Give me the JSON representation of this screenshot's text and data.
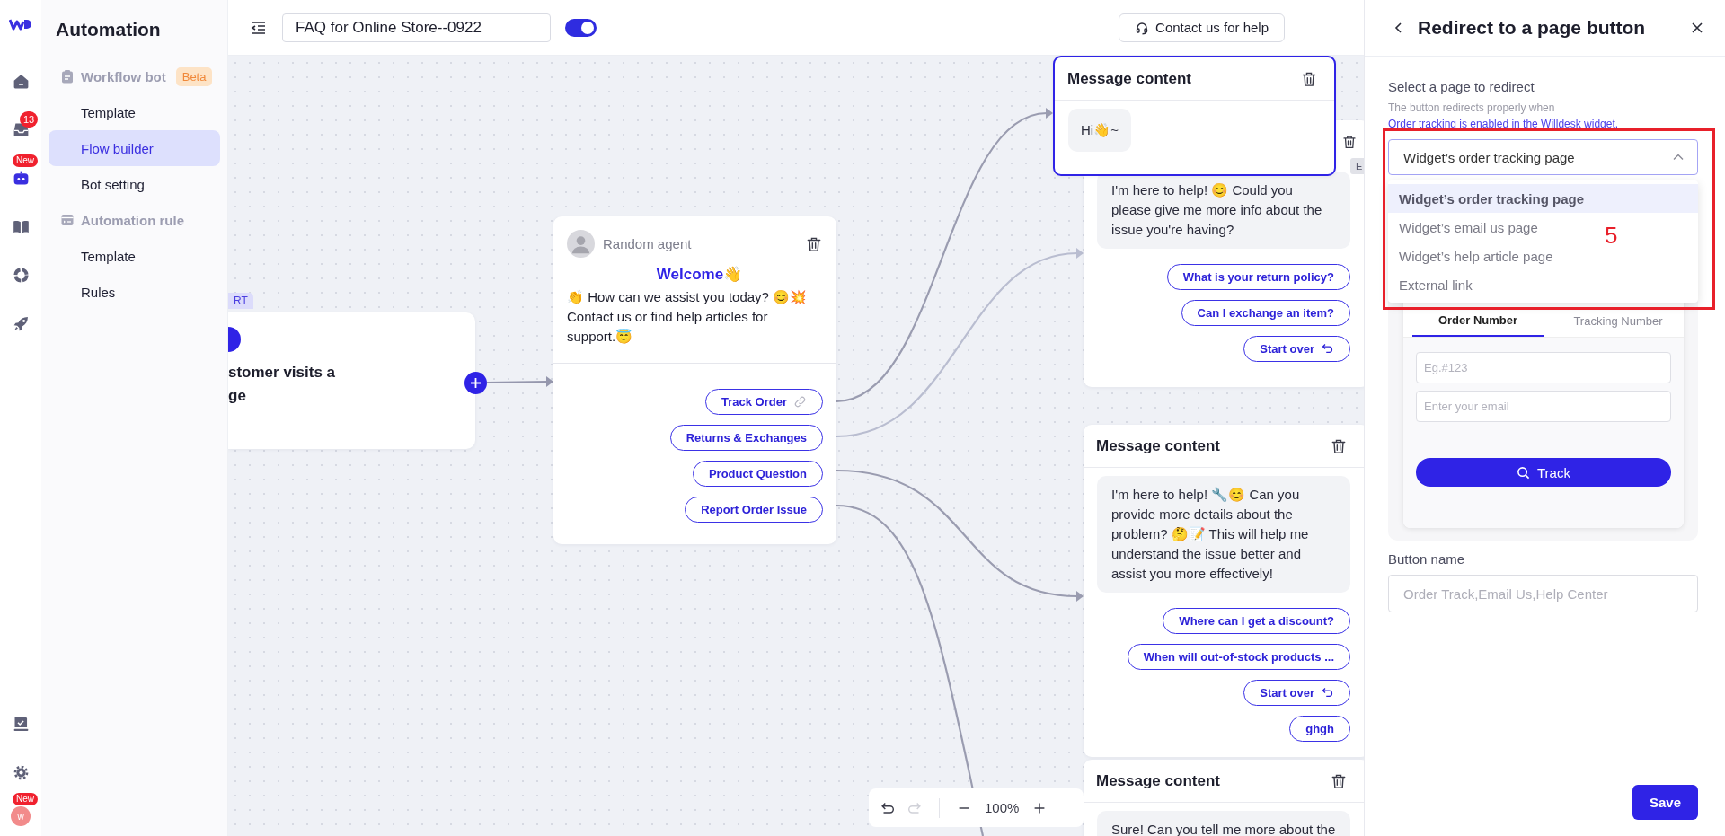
{
  "rail": {
    "items": [
      {
        "selected": false
      },
      {
        "selected": false,
        "badge": "13"
      },
      {
        "selected": true,
        "badge": "New"
      },
      {
        "selected": false
      },
      {
        "selected": false
      },
      {
        "selected": false
      }
    ],
    "bottom_items": [
      {
        "selected": false
      },
      {
        "selected": false
      }
    ],
    "avatar": {
      "initial": "w",
      "badge": "New"
    }
  },
  "sidebar": {
    "title": "Automation",
    "groups": [
      {
        "label": "Workflow bot",
        "badge": "Beta",
        "items": [
          {
            "label": "Template",
            "selected": false
          },
          {
            "label": "Flow builder",
            "selected": true
          },
          {
            "label": "Bot setting",
            "selected": false
          }
        ]
      },
      {
        "label": "Automation rule",
        "items": [
          {
            "label": "Template",
            "selected": false
          },
          {
            "label": "Rules",
            "selected": false
          }
        ]
      }
    ]
  },
  "topbar": {
    "flow_name": "FAQ for Online Store--0922",
    "enabled": true,
    "help_button": "Contact us for help"
  },
  "canvas": {
    "start_node": {
      "tag": "RT",
      "title_lines": [
        "stomer visits a",
        "ge"
      ]
    },
    "welcome_node": {
      "agent": "Random agent",
      "heading": "Welcome👋",
      "text": "👏 How can we assist you today? 😊💥 Contact us or find help articles for support.😇",
      "buttons": [
        {
          "label": "Track Order",
          "kind": "link"
        },
        {
          "label": "Returns & Exchanges",
          "kind": "reply"
        },
        {
          "label": "Product Question",
          "kind": "reply"
        },
        {
          "label": "Report Order Issue",
          "kind": "reply"
        }
      ]
    },
    "message_nodes": [
      {
        "title": "Message content",
        "selected": true,
        "text": "Hi👋~"
      },
      {
        "selected": false,
        "tag": "E",
        "text": "I'm here to help! 😊 Could you please give me more info about the issue you're having?",
        "buttons": [
          {
            "label": "What is your return policy?",
            "kind": "reply"
          },
          {
            "label": "Can I exchange an item?",
            "kind": "reply"
          },
          {
            "label": "Start over",
            "kind": "restart"
          }
        ]
      },
      {
        "title": "Message content",
        "selected": false,
        "text": "I'm here to help! 🔧😊 Can you provide more details about the problem? 🤔📝 This will help me understand the issue better and assist you more effectively!",
        "buttons": [
          {
            "label": "Where can I get a discount?",
            "kind": "reply"
          },
          {
            "label": "When will out-of-stock products ...",
            "kind": "reply"
          },
          {
            "label": "Start over",
            "kind": "restart"
          },
          {
            "label": "ghgh",
            "kind": "reply"
          }
        ]
      },
      {
        "title": "Message content",
        "selected": false,
        "text": "Sure! Can you tell me more about the"
      }
    ],
    "toolbar": {
      "undo": {
        "disabled": false
      },
      "redo": {
        "disabled": true
      },
      "zoom": "100%"
    }
  },
  "panel": {
    "title": "Redirect to a page button",
    "field_label": "Select a page to redirect",
    "hint": "The button redirects properly when",
    "hint_link": "Order tracking is enabled in the Willdesk widget.",
    "select": {
      "value": "Widget’s order tracking page",
      "expanded": true,
      "options": [
        {
          "label": "Widget’s order tracking page",
          "selected": true
        },
        {
          "label": "Widget’s email us page",
          "selected": false
        },
        {
          "label": "Widget’s help article page",
          "selected": false
        },
        {
          "label": "External link",
          "selected": false
        }
      ]
    },
    "preview": {
      "tabs": [
        {
          "label": "Order Number",
          "selected": true
        },
        {
          "label": "Tracking Number",
          "selected": false
        }
      ],
      "fields": [
        {
          "placeholder": "Eg.#123"
        },
        {
          "placeholder": "Enter your email"
        }
      ],
      "button": "Track"
    },
    "button_name": {
      "label": "Button name",
      "placeholder": "Order Track,Email Us,Help Center"
    },
    "save": "Save"
  },
  "annotation": {
    "label": "5"
  }
}
